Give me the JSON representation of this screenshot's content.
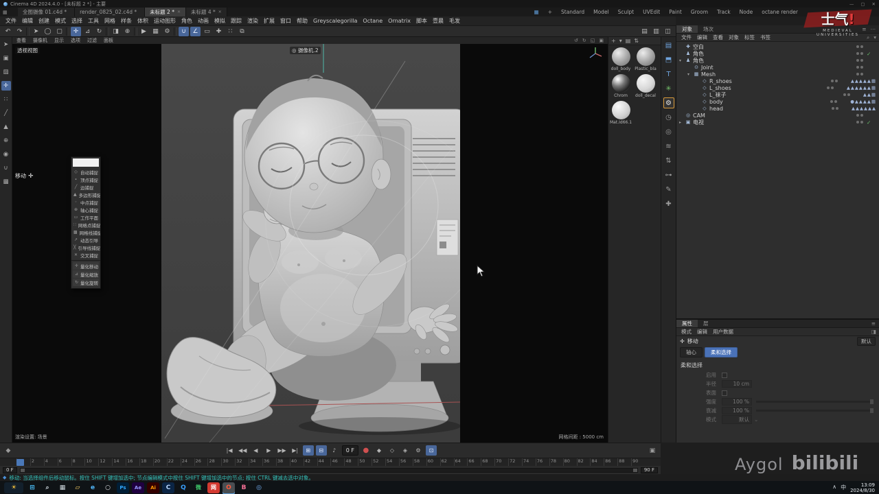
{
  "titlebar": {
    "app_title": "Cinema 4D 2024.4.0 - [未标题 2 *] - 主要",
    "minimize": "—",
    "maximize": "▢",
    "close": "✕"
  },
  "doc_tabs": {
    "tabs": [
      {
        "label": "全图摄像 01.c4d *",
        "cls": "",
        "close": ""
      },
      {
        "label": "render_0825_02.c4d *",
        "cls": "",
        "close": ""
      },
      {
        "label": "未标题 2 *",
        "cls": "active",
        "close": "✕"
      },
      {
        "label": "未标题 4 *",
        "cls": "",
        "close": "✕"
      }
    ],
    "add_label": "+",
    "layout_icon": "▦",
    "layouts": [
      {
        "label": "Standard"
      },
      {
        "label": "Model"
      },
      {
        "label": "Sculpt"
      },
      {
        "label": "UVEdit"
      },
      {
        "label": "Paint"
      },
      {
        "label": "Groom"
      },
      {
        "label": "Track"
      },
      {
        "label": "Node"
      },
      {
        "label": "octane render"
      }
    ]
  },
  "menubar": {
    "items": [
      {
        "label": "文件"
      },
      {
        "label": "编辑"
      },
      {
        "label": "创建"
      },
      {
        "label": "模式"
      },
      {
        "label": "选择"
      },
      {
        "label": "工具"
      },
      {
        "label": "网格"
      },
      {
        "label": "样条"
      },
      {
        "label": "体积"
      },
      {
        "label": "运动图形"
      },
      {
        "label": "角色"
      },
      {
        "label": "动画"
      },
      {
        "label": "模拟"
      },
      {
        "label": "跟踪"
      },
      {
        "label": "渲染"
      },
      {
        "label": "扩展"
      },
      {
        "label": "窗口"
      },
      {
        "label": "帮助"
      },
      {
        "label": "Greyscalegorilla"
      },
      {
        "label": "Octane"
      },
      {
        "label": "Ornatrix"
      },
      {
        "label": "脚本"
      },
      {
        "label": "壹晨"
      },
      {
        "label": "毛发"
      }
    ]
  },
  "toolbar": {
    "icons": [
      {
        "glyph": "↶",
        "name": "undo-icon",
        "cls": ""
      },
      {
        "glyph": "↷",
        "name": "redo-icon",
        "cls": ""
      },
      {
        "glyph": "",
        "name": "divider",
        "cls": "divider"
      },
      {
        "glyph": "➤",
        "name": "select-arrow-icon",
        "cls": ""
      },
      {
        "glyph": "◯",
        "name": "live-selection-icon",
        "cls": ""
      },
      {
        "glyph": "▢",
        "name": "rect-selection-icon",
        "cls": ""
      },
      {
        "glyph": "",
        "name": "divider",
        "cls": "divider"
      },
      {
        "glyph": "✛",
        "name": "move-tool-icon",
        "cls": "active"
      },
      {
        "glyph": "⊿",
        "name": "scale-tool-icon",
        "cls": ""
      },
      {
        "glyph": "↻",
        "name": "rotate-tool-icon",
        "cls": ""
      },
      {
        "glyph": "",
        "name": "divider",
        "cls": "divider"
      },
      {
        "glyph": "◨",
        "name": "last-tool-icon",
        "cls": ""
      },
      {
        "glyph": "⊕",
        "name": "coordinate-system-icon",
        "cls": ""
      },
      {
        "glyph": "",
        "name": "divider",
        "cls": "divider"
      },
      {
        "glyph": "▶",
        "name": "render-view-icon",
        "cls": ""
      },
      {
        "glyph": "▦",
        "name": "render-picture-viewer-icon",
        "cls": ""
      },
      {
        "glyph": "⚙",
        "name": "render-settings-icon",
        "cls": ""
      },
      {
        "glyph": "",
        "name": "divider",
        "cls": "divider"
      },
      {
        "glyph": "∪",
        "name": "snap-toggle-icon",
        "cls": "active"
      },
      {
        "glyph": "∠",
        "name": "quantize-toggle-icon",
        "cls": "active"
      },
      {
        "glyph": "▭",
        "name": "workplane-icon",
        "cls": ""
      },
      {
        "glyph": "✚",
        "name": "modeling-axis-icon",
        "cls": ""
      },
      {
        "glyph": "∷",
        "name": "grid-toggle-icon",
        "cls": ""
      },
      {
        "glyph": "⧉",
        "name": "mirror-tool-icon",
        "cls": ""
      },
      {
        "glyph": "▤",
        "name": "coordinates-manager-icon",
        "cls": "push"
      },
      {
        "glyph": "▥",
        "name": "content-browser-icon",
        "cls": ""
      },
      {
        "glyph": "◫",
        "name": "layout-toggle-icon",
        "cls": ""
      }
    ]
  },
  "left_palette": {
    "icons": [
      {
        "glyph": "➤",
        "name": "make-editable-icon",
        "cls": ""
      },
      {
        "glyph": "▣",
        "name": "model-mode-icon",
        "cls": ""
      },
      {
        "glyph": "▨",
        "name": "texture-mode-icon",
        "cls": ""
      },
      {
        "glyph": "✛",
        "name": "workplane-mode-icon",
        "cls": "active"
      },
      {
        "glyph": "∷",
        "name": "points-mode-icon",
        "cls": ""
      },
      {
        "glyph": "╱",
        "name": "edges-mode-icon",
        "cls": ""
      },
      {
        "glyph": "▲",
        "name": "polygons-mode-icon",
        "cls": ""
      },
      {
        "glyph": "⊕",
        "name": "enable-axis-icon",
        "cls": ""
      },
      {
        "glyph": "◉",
        "name": "viewport-solo-icon",
        "cls": ""
      },
      {
        "glyph": "∪",
        "name": "snap-enable-icon",
        "cls": ""
      },
      {
        "glyph": "▩",
        "name": "lock-workplane-icon",
        "cls": ""
      }
    ]
  },
  "viewport": {
    "menus": [
      {
        "label": "查看"
      },
      {
        "label": "摄像机"
      },
      {
        "label": "显示"
      },
      {
        "label": "选项"
      },
      {
        "label": "过滤"
      },
      {
        "label": "面板"
      }
    ],
    "corner_icons": [
      {
        "glyph": "↺",
        "name": "view-rotate-icon"
      },
      {
        "glyph": "↻",
        "name": "view-pan-icon"
      },
      {
        "glyph": "◱",
        "name": "view-zoom-icon"
      },
      {
        "glyph": "▣",
        "name": "view-maximize-icon"
      }
    ],
    "view_label": "透视视图",
    "camera_icon": "◎",
    "camera_label": "摄像机.2",
    "render_setting_label": "渲染设置: 场景",
    "grid_label": "网格间距 : 5000 cm",
    "tool_hint": "移动"
  },
  "snap_menu": {
    "items": [
      {
        "glyph": "◇",
        "label": "自动捕捉"
      },
      {
        "glyph": "∙",
        "label": "顶点捕捉"
      },
      {
        "glyph": "╱",
        "label": "边捕捉"
      },
      {
        "glyph": "▲",
        "label": "多边形捕捉"
      },
      {
        "glyph": "◦",
        "label": "中点捕捉"
      },
      {
        "glyph": "⊕",
        "label": "轴心捕捉"
      },
      {
        "glyph": "▭",
        "label": "工作平面"
      },
      {
        "glyph": "∷",
        "label": "网格点捕捉"
      },
      {
        "glyph": "▩",
        "label": "网格线捕捉"
      },
      {
        "glyph": "↗",
        "label": "动态引导"
      },
      {
        "glyph": "╳",
        "label": "引导线捕捉"
      },
      {
        "glyph": "✕",
        "label": "交叉捕捉"
      }
    ],
    "quantize": [
      {
        "glyph": "✛",
        "label": "量化移动"
      },
      {
        "glyph": "⊿",
        "label": "量化缩放"
      },
      {
        "glyph": "↻",
        "label": "量化旋转"
      }
    ]
  },
  "materials": {
    "toolbar": [
      {
        "glyph": "+",
        "name": "create-material-icon"
      },
      {
        "glyph": "▾",
        "name": "material-menu-icon"
      },
      {
        "glyph": "▤",
        "name": "material-view-icon"
      },
      {
        "glyph": "⇅",
        "name": "material-sort-icon"
      }
    ],
    "items": [
      {
        "name": "doll_body",
        "cls": "m-gray"
      },
      {
        "name": "Plastic_bla",
        "cls": "m-gray"
      },
      {
        "name": "Chrom",
        "cls": "m-chrome"
      },
      {
        "name": "doll_decal",
        "cls": "m-decal"
      },
      {
        "name": "Mat.Id66.1",
        "cls": "m-light"
      }
    ]
  },
  "right_dock": {
    "icons": [
      {
        "glyph": "▤",
        "name": "scene-manager-icon",
        "cls": "c-blue"
      },
      {
        "glyph": "⬒",
        "name": "object-library-icon",
        "cls": "c-blue"
      },
      {
        "glyph": "T",
        "name": "takes-icon",
        "cls": "c-blue"
      },
      {
        "glyph": "✳",
        "name": "simulation-icon",
        "cls": "c-green"
      },
      {
        "glyph": "⚙",
        "name": "settings-gear-icon",
        "cls": "active"
      },
      {
        "glyph": "◷",
        "name": "history-icon",
        "cls": ""
      },
      {
        "glyph": "◎",
        "name": "target-icon",
        "cls": ""
      },
      {
        "glyph": "≋",
        "name": "deformer-icon",
        "cls": ""
      },
      {
        "glyph": "⇅",
        "name": "exchange-icon",
        "cls": ""
      },
      {
        "glyph": "⊶",
        "name": "constraint-icon",
        "cls": ""
      },
      {
        "glyph": "✎",
        "name": "pen-icon",
        "cls": ""
      },
      {
        "glyph": "✚",
        "name": "axis-icon",
        "cls": ""
      }
    ]
  },
  "object_manager": {
    "panel_tabs": [
      {
        "label": "对象",
        "cls": "active"
      },
      {
        "label": "场次",
        "cls": ""
      }
    ],
    "header_icons": [
      {
        "glyph": "≡",
        "name": "om-menu-icon"
      },
      {
        "glyph": "⋯",
        "name": "om-more-icon"
      }
    ],
    "menu": [
      {
        "label": "文件"
      },
      {
        "label": "编辑"
      },
      {
        "label": "查看"
      },
      {
        "label": "对象"
      },
      {
        "label": "标签"
      },
      {
        "label": "书签"
      }
    ],
    "menu_icons": [
      {
        "glyph": "⌕",
        "name": "om-search-icon"
      },
      {
        "glyph": "▾",
        "name": "om-filter-icon"
      }
    ],
    "rows": [
      {
        "indent": "0",
        "exp": "",
        "icon": "✚",
        "name": "空白",
        "check": "",
        "tags": ""
      },
      {
        "indent": "0",
        "exp": "",
        "icon": "♟",
        "name": "角色",
        "check": "✓",
        "tags": ""
      },
      {
        "indent": "0",
        "exp": "▾",
        "icon": "♟",
        "name": "角色",
        "check": "",
        "tags": ""
      },
      {
        "indent": "1",
        "exp": "",
        "icon": "⊙",
        "name": "Joint",
        "check": "",
        "tags": ""
      },
      {
        "indent": "1",
        "exp": "▾",
        "icon": "▦",
        "name": "Mesh",
        "check": "",
        "tags": ""
      },
      {
        "indent": "2",
        "exp": "",
        "icon": "◇",
        "name": "R_shoes",
        "check": "",
        "tags": "▲▲▲▲▲▦"
      },
      {
        "indent": "2",
        "exp": "",
        "icon": "◇",
        "name": "L_shoes",
        "check": "",
        "tags": "▲▲▲▲▲▲▦"
      },
      {
        "indent": "2",
        "exp": "",
        "icon": "◇",
        "name": "L_袜子",
        "check": "",
        "tags": "▲▲▦"
      },
      {
        "indent": "2",
        "exp": "",
        "icon": "◇",
        "name": "body",
        "check": "",
        "tags": "●▲▲▲▲▦"
      },
      {
        "indent": "2",
        "exp": "",
        "icon": "◇",
        "name": "head",
        "check": "",
        "tags": "▲▲▲▲▲▲"
      },
      {
        "indent": "0",
        "exp": "",
        "icon": "◎",
        "name": "CAM",
        "check": "",
        "tags": ""
      },
      {
        "indent": "0",
        "exp": "▸",
        "icon": "▣",
        "name": "电视",
        "check": "✓",
        "tags": ""
      }
    ]
  },
  "attributes": {
    "panel_tabs": [
      {
        "label": "属性",
        "cls": "active"
      },
      {
        "label": "层",
        "cls": ""
      }
    ],
    "header_icons": [
      {
        "glyph": "≡",
        "name": "attr-menu-icon"
      }
    ],
    "menu": [
      {
        "label": "模式"
      },
      {
        "label": "编辑"
      },
      {
        "label": "用户数据"
      }
    ],
    "menu_icons": [
      {
        "glyph": "◨",
        "name": "attr-lock-icon"
      }
    ],
    "tool_icon": "✛",
    "tool_title": "移动",
    "preset_label": "默认",
    "subtabs": [
      {
        "label": "轴心",
        "cls": ""
      },
      {
        "label": "柔和选择",
        "cls": "active"
      }
    ],
    "section_title": "柔和选择",
    "rows": [
      {
        "label": "启用",
        "value": "",
        "ctl": "check"
      },
      {
        "label": "半径",
        "value": "10 cm",
        "ctl": "num"
      },
      {
        "label": "表面",
        "value": "",
        "ctl": "check"
      },
      {
        "label": "强度",
        "value": "100 %",
        "ctl": "slider"
      },
      {
        "label": "衰减",
        "value": "100 %",
        "ctl": "slider"
      },
      {
        "label": "模式",
        "value": "默认",
        "ctl": "dropdown"
      }
    ]
  },
  "timeline": {
    "left_icon": "◆",
    "right_icon": "▣",
    "controls": [
      {
        "glyph": "|◀",
        "name": "goto-start-icon",
        "cls": ""
      },
      {
        "glyph": "◀◀",
        "name": "prev-key-icon",
        "cls": ""
      },
      {
        "glyph": "◀",
        "name": "prev-frame-icon",
        "cls": ""
      },
      {
        "glyph": "▶",
        "name": "play-icon",
        "cls": ""
      },
      {
        "glyph": "▶▶",
        "name": "next-key-icon",
        "cls": ""
      },
      {
        "glyph": "▶|",
        "name": "goto-end-icon",
        "cls": ""
      },
      {
        "glyph": "⊞",
        "name": "frame-snap-icon",
        "cls": "active"
      },
      {
        "glyph": "⊟",
        "name": "frame-mode-icon",
        "cls": "active"
      },
      {
        "glyph": "♪",
        "name": "sound-toggle-icon",
        "cls": ""
      },
      {
        "glyph": "0 F",
        "name": "current-frame-field",
        "cls": "field"
      },
      {
        "glyph": "●",
        "name": "record-keyframe-icon",
        "cls": "red"
      },
      {
        "glyph": "◆",
        "name": "key-position-icon",
        "cls": ""
      },
      {
        "glyph": "◇",
        "name": "key-scale-icon",
        "cls": ""
      },
      {
        "glyph": "◈",
        "name": "key-rotation-icon",
        "cls": ""
      },
      {
        "glyph": "⚙",
        "name": "key-settings-icon",
        "cls": ""
      },
      {
        "glyph": "⊡",
        "name": "autokey-icon",
        "cls": "active"
      }
    ],
    "ruler": [
      "0",
      "2",
      "4",
      "6",
      "8",
      "10",
      "12",
      "14",
      "16",
      "18",
      "20",
      "22",
      "24",
      "26",
      "28",
      "30",
      "32",
      "34",
      "36",
      "38",
      "40",
      "42",
      "44",
      "46",
      "48",
      "50",
      "52",
      "54",
      "56",
      "58",
      "60",
      "62",
      "64",
      "66",
      "68",
      "70",
      "72",
      "74",
      "76",
      "78",
      "80",
      "82",
      "84",
      "86",
      "88",
      "90"
    ],
    "range_start": "0 F",
    "range_end": "90 F"
  },
  "statusbar": {
    "text": "移动: 当选择组件后移动鼠标。按住 SHIFT 键增加选中; 节点编辑模式中按住 SHIFT 键增加选中的节点; 按住 CTRL 键减去选中对象。"
  },
  "taskbar": {
    "icons": [
      {
        "glyph": "☀",
        "style": "background:#13202c;color:#ffc83d;width:28px",
        "name": "weather-widget",
        "cls": ""
      },
      {
        "glyph": "⊞",
        "style": "color:#4cc2ff",
        "name": "start-button",
        "cls": ""
      },
      {
        "glyph": "⌕",
        "style": "color:#cfd8de",
        "name": "search-icon",
        "cls": ""
      },
      {
        "glyph": "▦",
        "style": "color:#cfd8de",
        "name": "task-view-icon",
        "cls": ""
      },
      {
        "glyph": "▱",
        "style": "color:#ffd267",
        "name": "file-explorer-icon",
        "cls": ""
      },
      {
        "glyph": "e",
        "style": "color:#52b9ff",
        "name": "edge-icon",
        "cls": ""
      },
      {
        "glyph": "○",
        "style": "color:#e8eaed",
        "name": "browser-icon",
        "cls": ""
      },
      {
        "glyph": "Ps",
        "style": "background:#001e36;color:#31a8ff;font-size:7px",
        "name": "photoshop-icon",
        "cls": ""
      },
      {
        "glyph": "Ae",
        "style": "background:#1f0040;color:#9999ff;font-size:7px",
        "name": "after-effects-icon",
        "cls": ""
      },
      {
        "glyph": "Ai",
        "style": "background:#330000;color:#ff9a00;font-size:7px",
        "name": "illustrator-icon",
        "cls": ""
      },
      {
        "glyph": "C",
        "style": "background:#0b2545;color:#bcd8ff",
        "name": "cinema4d-icon",
        "cls": ""
      },
      {
        "glyph": "Q",
        "style": "color:#3aa0ff",
        "name": "qq-icon",
        "cls": ""
      },
      {
        "glyph": "微",
        "style": "color:#3ec368;font-size:8px",
        "name": "wechat-icon",
        "cls": ""
      },
      {
        "glyph": "网",
        "style": "background:#d33a31;color:#fff;font-size:8px",
        "name": "netease-music-icon",
        "cls": ""
      },
      {
        "glyph": "O",
        "style": "background:#3a3f44;color:#ff5a3c",
        "name": "octane-icon",
        "cls": "running"
      },
      {
        "glyph": "B",
        "style": "color:#fb7299",
        "name": "bilibili-app-icon",
        "cls": ""
      },
      {
        "glyph": "◎",
        "style": "color:#7ab8ff",
        "name": "recorder-icon",
        "cls": ""
      }
    ],
    "tray_icons": [
      {
        "glyph": "∧",
        "name": "tray-expand-icon"
      },
      {
        "glyph": "中",
        "name": "ime-indicator"
      }
    ],
    "time": "13:09",
    "date": "2024/8/30"
  },
  "watermark": {
    "name": "Aygol",
    "brand": "bilibili"
  },
  "logo": {
    "title": "士气",
    "bang": "!",
    "subtitle": "MEDIEVAL UNIVERSITIES"
  }
}
